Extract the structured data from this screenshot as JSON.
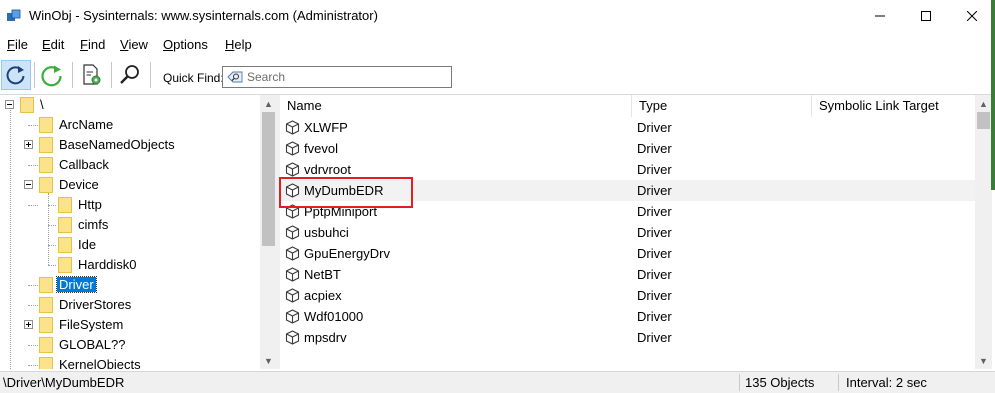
{
  "window": {
    "title": "WinObj - Sysinternals: www.sysinternals.com (Administrator)"
  },
  "menu": [
    {
      "mnemonic": "F",
      "rest": "ile"
    },
    {
      "mnemonic": "E",
      "rest": "dit"
    },
    {
      "mnemonic": "F",
      "rest": "ind"
    },
    {
      "mnemonic": "V",
      "rest": "iew"
    },
    {
      "mnemonic": "O",
      "rest": "ptions"
    },
    {
      "mnemonic": "H",
      "rest": "elp"
    }
  ],
  "toolbar": {
    "quick_find_label": "Quick Find:",
    "search_placeholder": "Search",
    "icons": [
      "refresh-icon",
      "auto-refresh-icon",
      "properties-icon",
      "find-icon"
    ]
  },
  "tree": {
    "items": [
      {
        "label": "\\",
        "expanded": true
      },
      {
        "label": "ArcName"
      },
      {
        "label": "BaseNamedObjects",
        "collapsed": true
      },
      {
        "label": "Callback"
      },
      {
        "label": "Device",
        "expanded": true
      },
      {
        "label": "Http"
      },
      {
        "label": "cimfs"
      },
      {
        "label": "Ide"
      },
      {
        "label": "Harddisk0"
      },
      {
        "label": "Driver",
        "selected": true
      },
      {
        "label": "DriverStores"
      },
      {
        "label": "FileSystem",
        "collapsed": true
      },
      {
        "label": "GLOBAL??"
      },
      {
        "label": "KernelObjects"
      }
    ]
  },
  "list": {
    "columns": [
      "Name",
      "Type",
      "Symbolic Link Target"
    ],
    "rows": [
      {
        "name": "XLWFP",
        "type": "Driver"
      },
      {
        "name": "fvevol",
        "type": "Driver"
      },
      {
        "name": "vdrvroot",
        "type": "Driver"
      },
      {
        "name": "MyDumbEDR",
        "type": "Driver",
        "highlighted": true
      },
      {
        "name": "PptpMiniport",
        "type": "Driver"
      },
      {
        "name": "usbuhci",
        "type": "Driver"
      },
      {
        "name": "GpuEnergyDrv",
        "type": "Driver"
      },
      {
        "name": "NetBT",
        "type": "Driver"
      },
      {
        "name": "acpiex",
        "type": "Driver"
      },
      {
        "name": "Wdf01000",
        "type": "Driver"
      },
      {
        "name": "mpsdrv",
        "type": "Driver"
      }
    ]
  },
  "status": {
    "path": "\\Driver\\MyDumbEDR",
    "count": "135 Objects",
    "interval": "Interval: 2 sec"
  },
  "colors": {
    "selection": "#0078d7",
    "annotation": "#e02020",
    "folder": "#fbe28c"
  }
}
